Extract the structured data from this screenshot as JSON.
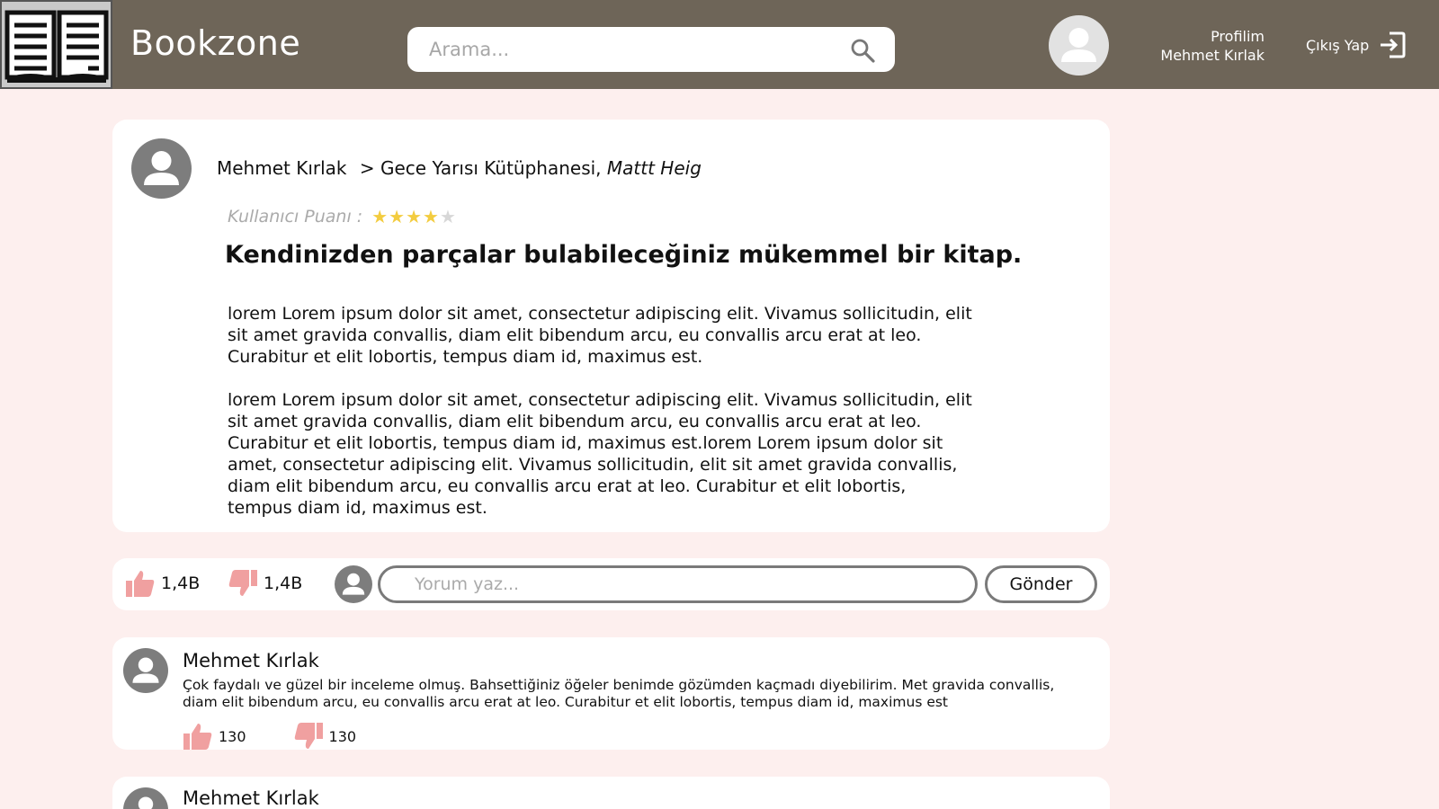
{
  "header": {
    "brand": "Bookzone",
    "search_placeholder": "Arama...",
    "profile_label": "Profilim",
    "user_name": "Mehmet Kırlak",
    "logout_label": "Çıkış Yap"
  },
  "review": {
    "author": "Mehmet Kırlak",
    "book_prefix": "> Gece Yarısı Kütüphanesi,",
    "book_author": "Mattt Heig",
    "rating_label": "Kullanıcı Puanı :",
    "rating": 4,
    "rating_max": 5,
    "title": "Kendinizden parçalar bulabileceğiniz mükemmel bir kitap.",
    "paragraphs": [
      "lorem Lorem ipsum dolor sit amet, consectetur adipiscing elit. Vivamus sollicitudin, elit sit amet gravida convallis, diam elit bibendum arcu, eu convallis arcu erat at leo. Curabitur et elit lobortis, tempus diam id, maximus est.",
      "lorem Lorem ipsum dolor sit amet, consectetur adipiscing elit. Vivamus sollicitudin, elit sit amet gravida convallis, diam elit bibendum arcu, eu convallis arcu erat at leo. Curabitur et elit lobortis, tempus diam id, maximus est.lorem Lorem ipsum dolor sit amet, consectetur adipiscing elit. Vivamus sollicitudin, elit sit amet gravida convallis, diam elit bibendum arcu, eu convallis arcu erat at leo. Curabitur et elit lobortis, tempus diam id, maximus est."
    ]
  },
  "actions": {
    "likes": "1,4B",
    "dislikes": "1,4B",
    "comment_placeholder": "Yorum yaz...",
    "send_label": "Gönder"
  },
  "comments": [
    {
      "author": "Mehmet Kırlak",
      "text": "Çok faydalı ve güzel bir inceleme olmuş. Bahsettiğiniz öğeler benimde gözümden kaçmadı diyebilirim. Met gravida convallis, diam elit bibendum arcu, eu convallis arcu erat at leo. Curabitur et elit lobortis, tempus diam id, maximus est",
      "likes": "130",
      "dislikes": "130"
    },
    {
      "author": "Mehmet Kırlak"
    }
  ],
  "colors": {
    "header_bg": "#6e6558",
    "page_bg": "#fdefee",
    "vote_icon": "#f0a0a0",
    "star": "#f3cc3f"
  },
  "icons": [
    "book-logo-icon",
    "search-icon",
    "user-icon",
    "logout-icon",
    "thumbs-up-icon",
    "thumbs-down-icon"
  ]
}
